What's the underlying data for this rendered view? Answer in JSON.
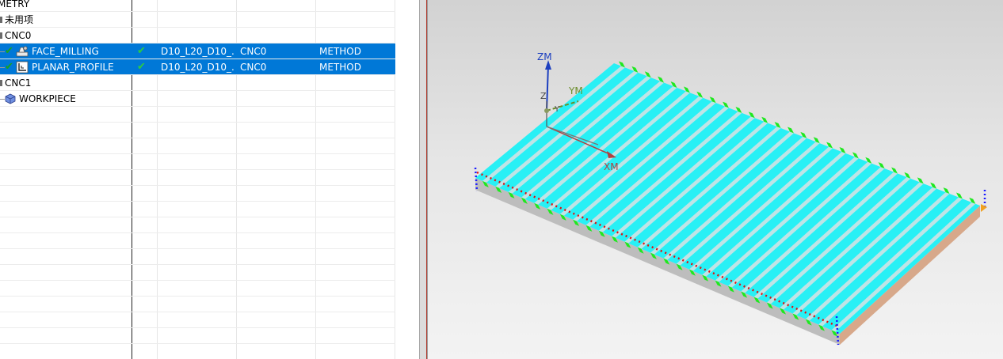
{
  "navigator": {
    "header_partial": "METRY",
    "rows": [
      {
        "name": "未用项"
      },
      {
        "name": "CNC0"
      },
      {
        "name": "FACE_MILLING",
        "path_status": "✔",
        "tool": "D10_L20_D10_...",
        "geometry": "CNC0",
        "method": "METHOD"
      },
      {
        "name": "PLANAR_PROFILE",
        "path_status": "✔",
        "tool": "D10_L20_D10_...",
        "geometry": "CNC0",
        "method": "METHOD"
      },
      {
        "name": "CNC1"
      },
      {
        "name": "WORKPIECE"
      }
    ]
  },
  "viewport": {
    "axes": {
      "zm": "ZM",
      "ym": "YM",
      "xm": "XM",
      "z": "Z",
      "y": "Y"
    },
    "colors": {
      "face": "#28f0f5",
      "slot": "#bfe4e6",
      "pad": "#1fe81f",
      "side": "#bdbdbd",
      "dash_red": "#e01010",
      "dash_blue": "#1a1aff",
      "csys_z": "#1c3fbf",
      "csys_y": "#6a8c2a",
      "csys_x": "#b04040"
    },
    "slot_count": 28
  }
}
